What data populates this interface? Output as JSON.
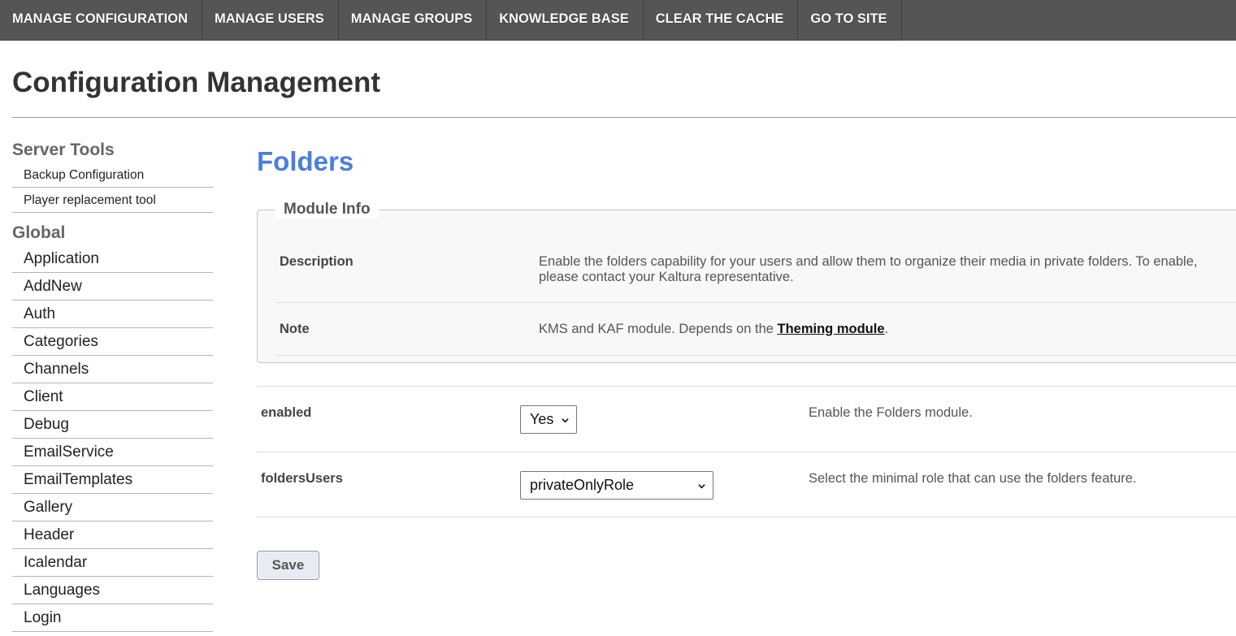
{
  "topnav": {
    "items": [
      "MANAGE CONFIGURATION",
      "MANAGE USERS",
      "MANAGE GROUPS",
      "KNOWLEDGE BASE",
      "CLEAR THE CACHE",
      "GO TO SITE"
    ]
  },
  "page": {
    "title": "Configuration Management"
  },
  "sidebar": {
    "server_tools_heading": "Server Tools",
    "server_tools": [
      "Backup Configuration",
      "Player replacement tool"
    ],
    "global_heading": "Global",
    "global_items": [
      "Application",
      "AddNew",
      "Auth",
      "Categories",
      "Channels",
      "Client",
      "Debug",
      "EmailService",
      "EmailTemplates",
      "Gallery",
      "Header",
      "Icalendar",
      "Languages",
      "Login"
    ]
  },
  "main": {
    "heading": "Folders",
    "module_info": {
      "legend": "Module Info",
      "description_label": "Description",
      "description_text": "Enable the folders capability for your users and allow them to organize their media in private folders. To enable, please contact your Kaltura representative.",
      "note_label": "Note",
      "note_prefix": "KMS and KAF module. Depends on the ",
      "note_link": "Theming module",
      "note_suffix": "."
    },
    "settings": [
      {
        "label": "enabled",
        "value": "Yes",
        "help": "Enable the Folders module."
      },
      {
        "label": "foldersUsers",
        "value": "privateOnlyRole",
        "help": "Select the minimal role that can use the folders feature."
      }
    ],
    "save_label": "Save"
  },
  "colors": {
    "nav_bg": "#555555",
    "heading_accent": "#4c7de0",
    "sidebar_heading": "#666666"
  }
}
